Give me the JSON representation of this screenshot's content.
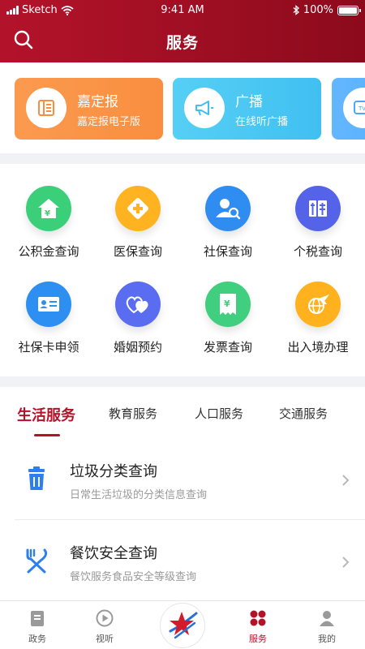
{
  "status_bar": {
    "carrier": "Sketch",
    "time": "9:41 AM",
    "battery": "100%"
  },
  "header": {
    "title": "服务"
  },
  "promo_cards": [
    {
      "title": "嘉定报",
      "subtitle": "嘉定报电子版",
      "icon": "newspaper-icon"
    },
    {
      "title": "广播",
      "subtitle": "在线听广播",
      "icon": "megaphone-icon"
    },
    {
      "title": "",
      "subtitle": "",
      "icon": "tv-icon"
    }
  ],
  "services": [
    {
      "label": "公积金查询",
      "icon": "house-yen-icon",
      "color": "#3ccf7a"
    },
    {
      "label": "医保查询",
      "icon": "medical-cross-icon",
      "color": "#ffb320"
    },
    {
      "label": "社保查询",
      "icon": "person-search-icon",
      "color": "#2f8cf0"
    },
    {
      "label": "个税查询",
      "icon": "tax-icon",
      "color": "#5563e8"
    },
    {
      "label": "社保卡申领",
      "icon": "id-card-icon",
      "color": "#2e8ff3"
    },
    {
      "label": "婚姻预约",
      "icon": "hearts-icon",
      "color": "#5a6cf0"
    },
    {
      "label": "发票查询",
      "icon": "invoice-icon",
      "color": "#3fcf7e"
    },
    {
      "label": "出入境办理",
      "icon": "globe-plane-icon",
      "color": "#ffb21e"
    }
  ],
  "category_tabs": [
    {
      "label": "生活服务",
      "active": true
    },
    {
      "label": "教育服务",
      "active": false
    },
    {
      "label": "人口服务",
      "active": false
    },
    {
      "label": "交通服务",
      "active": false
    }
  ],
  "list_items": [
    {
      "title": "垃圾分类查询",
      "subtitle": "日常生活垃圾的分类信息查询",
      "icon": "trash-icon"
    },
    {
      "title": "餐饮安全查询",
      "subtitle": "餐饮服务食品安全等级查询",
      "icon": "fork-knife-icon"
    }
  ],
  "bottom_tabs": [
    {
      "label": "政务",
      "icon": "document-icon",
      "active": false
    },
    {
      "label": "视听",
      "icon": "play-icon",
      "active": false
    },
    {
      "label": "服务",
      "icon": "services-icon",
      "active": true
    },
    {
      "label": "我的",
      "icon": "profile-icon",
      "active": false
    }
  ],
  "colors": {
    "brand": "#b3132a",
    "orange": "#fb9a4f",
    "cyan": "#4cc7f3"
  }
}
